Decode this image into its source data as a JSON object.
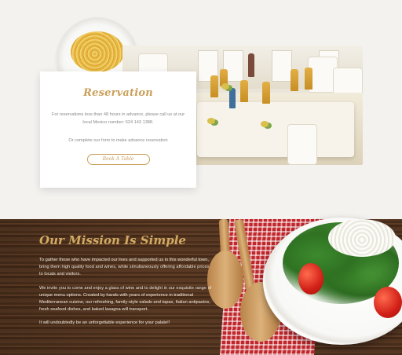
{
  "reservation": {
    "title": "Reservation",
    "text1": "For reservations less than 48 hours in advance, please call us at our local Mexico number: 624 143 1388.",
    "text2": "Or complete our form to make advance reservation",
    "button_label": "Book A Table",
    "accent_color": "#c9a05a"
  },
  "mission": {
    "title": "Our Mission Is Simple",
    "para1": "To gather those who have impacted our lives and supported us in this wonderful town, bring them high quality food and wines, while simultaneously offering affordable prices to locals and visitors.",
    "para2": "We invite you to come and enjoy a glass of wine and to delight in our exquisite range of unique menu options. Created by hands with years of experience in traditional Mediterranean cuisine, our refreshing, family-style salads and tapas, Italian antipastos, fresh seafood dishes, and baked lasagna will transport.",
    "para3": "It will undoubtedly be an unforgettable experience for your palate!!"
  }
}
